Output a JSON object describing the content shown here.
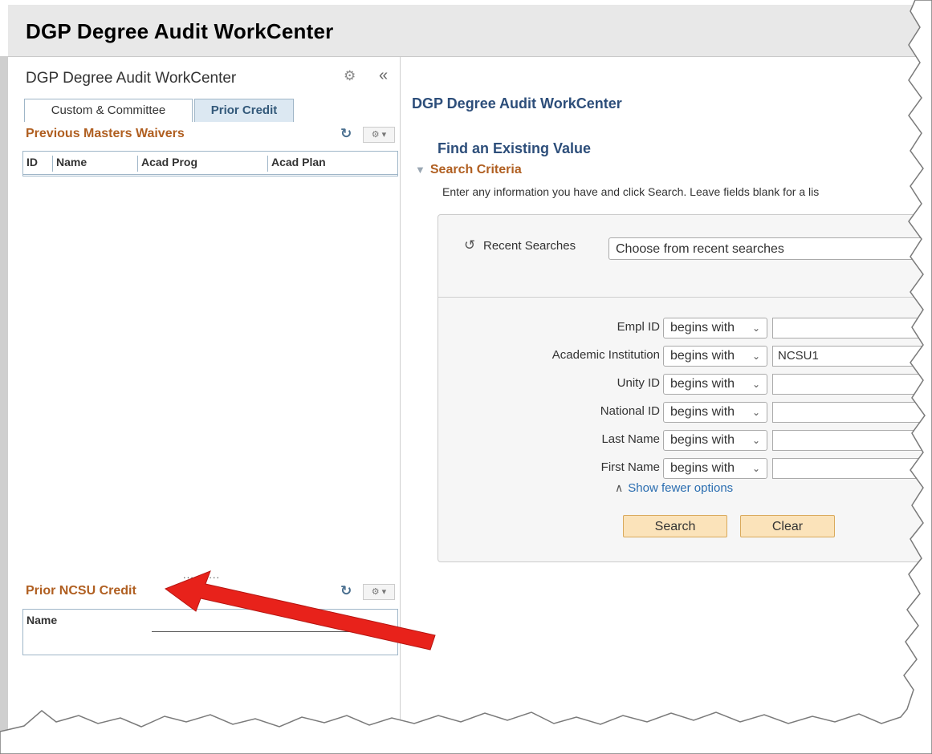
{
  "banner": {
    "title": "DGP Degree Audit WorkCenter"
  },
  "workcenter": {
    "title": "DGP Degree Audit WorkCenter",
    "gear_icon": "gear-icon",
    "collapse_icon": "double-chevron-left-icon",
    "tabs": [
      {
        "label": "Custom & Committee",
        "selected": false
      },
      {
        "label": "Prior Credit",
        "selected": true
      }
    ],
    "pagelets": {
      "waivers": {
        "title": "Previous Masters Waivers",
        "columns": [
          "ID",
          "Name",
          "Acad Prog",
          "Acad Plan"
        ]
      },
      "prior_credit": {
        "title": "Prior NCSU Credit",
        "columns": [
          "Name"
        ]
      }
    },
    "splitter": "..........",
    "refresh_icon": "refresh-icon",
    "options_icon": "gear-dropdown-icon"
  },
  "content": {
    "page_title": "DGP Degree Audit WorkCenter",
    "find_title": "Find an Existing Value",
    "criteria_label": "Search Criteria",
    "instructions": "Enter any information you have and click Search. Leave fields blank for a lis",
    "recent": {
      "label": "Recent Searches",
      "placeholder": "Choose from recent searches",
      "icon": "history-icon"
    },
    "fields": [
      {
        "label": "Empl ID",
        "operator": "begins with",
        "value": ""
      },
      {
        "label": "Academic Institution",
        "operator": "begins with",
        "value": "NCSU1"
      },
      {
        "label": "Unity ID",
        "operator": "begins with",
        "value": ""
      },
      {
        "label": "National ID",
        "operator": "begins with",
        "value": ""
      },
      {
        "label": "Last Name",
        "operator": "begins with",
        "value": ""
      },
      {
        "label": "First Name",
        "operator": "begins with",
        "value": ""
      }
    ],
    "show_fewer": "Show fewer options",
    "buttons": {
      "search": "Search",
      "clear": "Clear"
    }
  },
  "colors": {
    "accent_orange": "#b05f21",
    "title_blue": "#2d4e7a",
    "link_blue": "#2a6db0",
    "button_bg": "#fbe3ba",
    "annotation_red": "#e8221b"
  }
}
